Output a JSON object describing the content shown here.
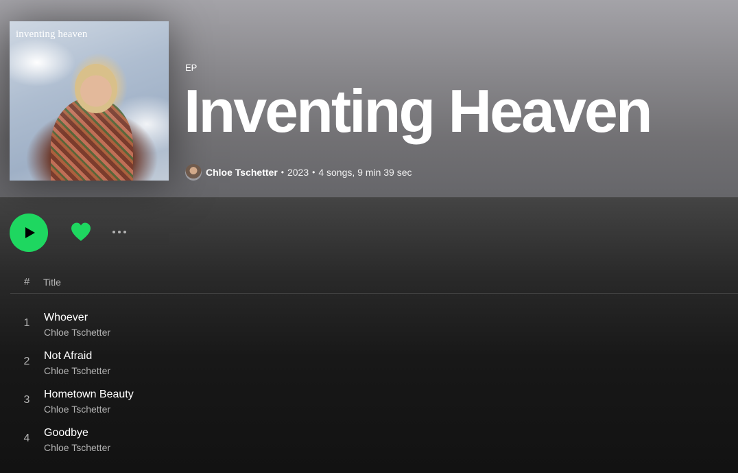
{
  "album": {
    "cover_text": "inventing heaven",
    "type_label": "EP",
    "title": "Inventing Heaven",
    "artist": "Chloe Tschetter",
    "separator": "•",
    "year": "2023",
    "summary": "4 songs, 9 min 39 sec"
  },
  "controls": {
    "play": "play-icon",
    "like": "heart-icon",
    "more": "more-options-icon"
  },
  "list_header": {
    "number": "#",
    "title": "Title"
  },
  "tracks": [
    {
      "number": "1",
      "title": "Whoever",
      "artist": "Chloe Tschetter"
    },
    {
      "number": "2",
      "title": "Not Afraid",
      "artist": "Chloe Tschetter"
    },
    {
      "number": "3",
      "title": "Hometown Beauty",
      "artist": "Chloe Tschetter"
    },
    {
      "number": "4",
      "title": "Goodbye",
      "artist": "Chloe Tschetter"
    }
  ],
  "colors": {
    "accent": "#1ed760",
    "background": "#121212",
    "secondary_text": "#b3b3b3"
  }
}
